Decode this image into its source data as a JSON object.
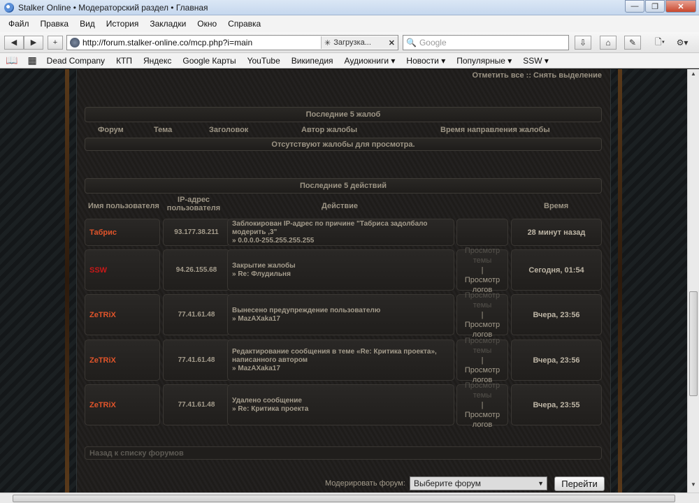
{
  "window": {
    "title": "Stalker Online • Модераторский раздел • Главная"
  },
  "menu": [
    "Файл",
    "Правка",
    "Вид",
    "История",
    "Закладки",
    "Окно",
    "Справка"
  ],
  "nav": {
    "url": "http://forum.stalker-online.co/mcp.php?i=main",
    "loading": "Загрузка...",
    "search_placeholder": "Google"
  },
  "bookmarks": [
    "Dead Company",
    "КТП",
    "Яндекс",
    "Google Карты",
    "YouTube",
    "Википедия",
    "Аудиокниги ▾",
    "Новости ▾",
    "Популярные ▾",
    "SSW ▾"
  ],
  "page": {
    "top_links": "Отметить все :: Снять выделение",
    "reports": {
      "title": "Последние 5 жалоб",
      "headers": [
        "Форум",
        "Тема",
        "Заголовок",
        "Автор жалобы",
        "Время направления жалобы"
      ],
      "empty": "Отсутствуют жалобы для просмотра."
    },
    "actions": {
      "title": "Последние 5 действий",
      "headers": [
        "Имя пользователя",
        "IP-адрес пользователя",
        "Действие",
        "Время"
      ],
      "rows": [
        {
          "user": "Табрис",
          "user_color": "#e0542a",
          "ip": "93.177.38.211",
          "action1": "Заблокирован IP-адрес по причине \"Табриса задолбало модерить ,3\"",
          "action2": "» 0.0.0.0-255.255.255.255",
          "link1": "",
          "link2": "",
          "time": "28 минут назад"
        },
        {
          "user": "SSW",
          "user_color": "#c81818",
          "ip": "94.26.155.68",
          "action1": "Закрытие жалобы",
          "action2": "» Re: Флудильня",
          "link1": "Просмотр темы",
          "link2": "Просмотр логов",
          "time": "Сегодня, 01:54"
        },
        {
          "user": "ZeTRiX",
          "user_color": "#e0542a",
          "ip": "77.41.61.48",
          "action1": "Вынесено предупреждение пользователю",
          "action2": "» MazAXaka17",
          "link1": "Просмотр темы",
          "link2": "Просмотр логов",
          "time": "Вчера, 23:56"
        },
        {
          "user": "ZeTRiX",
          "user_color": "#e0542a",
          "ip": "77.41.61.48",
          "action1": "Редактирование сообщения в теме «Re: Критика проекта», написанного автором",
          "action2": "» MazAXaka17",
          "link1": "Просмотр темы",
          "link2": "Просмотр логов",
          "time": "Вчера, 23:56"
        },
        {
          "user": "ZeTRiX",
          "user_color": "#e0542a",
          "ip": "77.41.61.48",
          "action1": "Удалено сообщение",
          "action2": "» Re: Критика проекта",
          "link1": "Просмотр темы",
          "link2": "Просмотр логов",
          "time": "Вчера, 23:55"
        }
      ]
    },
    "back_link": "Назад к списку форумов",
    "moderate_label": "Модерировать форум:",
    "forum_select": "Выберите форум",
    "go_button": "Перейти"
  }
}
